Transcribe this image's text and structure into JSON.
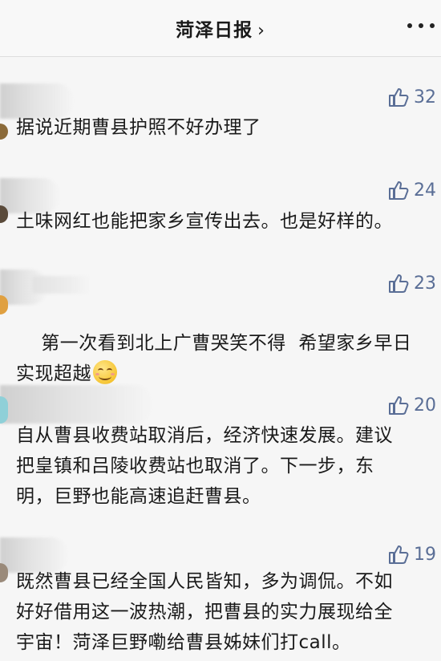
{
  "header": {
    "title": "菏泽日报",
    "chevron": "›",
    "more_icon": "more-horizontal-icon"
  },
  "comments": [
    {
      "likes": "32",
      "text": "据说近期曹县护照不好办理了",
      "avatar_tint": "#8b6a3a"
    },
    {
      "likes": "24",
      "text": "土味网红也能把家乡宣传出去。也是好样的。",
      "avatar_tint": "#5a4a3a"
    },
    {
      "likes": "23",
      "text": "第一次看到北上广曹哭笑不得  希望家乡早日\n实现超越",
      "emoji": "smiling-face-emoji",
      "avatar_tint": "#e0a040"
    },
    {
      "likes": "20",
      "text": "自从曹县收费站取消后，经济快速发展。建议\n把皇镇和吕陵收费站也取消了。下一步，东\n明，巨野也能高速追赶曹县。",
      "avatar_tint": "#8fd0d8"
    },
    {
      "likes": "19",
      "text": "既然曹县已经全国人民皆知，多为调侃。不如\n好好借用这一波热潮，把曹县的实力展现给全\n宇宙！菏泽巨野嘞给曹县姊妹们打call。",
      "avatar_tint": "#9a8a7a"
    }
  ]
}
